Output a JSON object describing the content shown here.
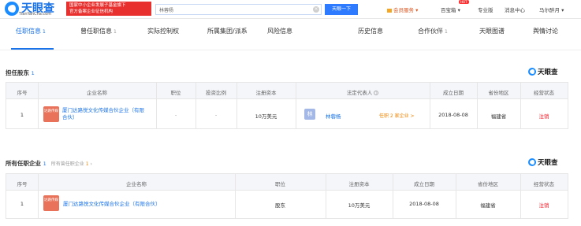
{
  "header": {
    "logo_text": "天眼查",
    "logo_sub": "TianYanCha.com",
    "banner_line1": "国家中小企业发展子基金旗下",
    "banner_line2": "官方备案企业征信机构",
    "search_value": "林蓉杨",
    "search_button": "天眼一下",
    "vip_label": "会员服务",
    "baibaoxiang": "百宝箱",
    "hot_tag": "HOT",
    "pro_label": "专业版",
    "message_label": "消息中心",
    "user_label": "马尔醉月"
  },
  "tabs": [
    {
      "label": "任职信息",
      "count": "1"
    },
    {
      "label": "曾任职信息",
      "count": "1"
    },
    {
      "label": "实际控制权",
      "count": ""
    },
    {
      "label": "所属集团/派系",
      "count": ""
    },
    {
      "label": "风险信息",
      "count": ""
    },
    {
      "label": "历史信息",
      "count": ""
    },
    {
      "label": "合作伙伴",
      "count": "1"
    },
    {
      "label": "天眼图谱",
      "count": ""
    },
    {
      "label": "舆情讨论",
      "count": ""
    }
  ],
  "section1": {
    "title": "担任股东",
    "count": "1",
    "brand": "天眼查",
    "headers": [
      "序号",
      "企业名称",
      "职位",
      "投资比例",
      "注册资本",
      "法定代表人",
      "成立日期",
      "省份地区",
      "经营状态"
    ],
    "row": {
      "index": "1",
      "logo_text": "达路传媒",
      "company": "厦门达路悦文化传媒合伙企业（有限合伙）",
      "position": "-",
      "ratio": "-",
      "capital": "10万美元",
      "rep_avatar": "林",
      "rep_name": "林蓉杨",
      "rep_tag": "任职 2 家企业 >",
      "date": "2018-08-08",
      "region": "福建省",
      "status": "注销"
    }
  },
  "section2": {
    "title": "所有任职企业",
    "count": "1",
    "history_label": "所有曾任职企业",
    "history_count": "1",
    "brand": "天眼查",
    "headers": [
      "序号",
      "企业名称",
      "职位",
      "注册资本",
      "成立日期",
      "省份地区",
      "经营状态"
    ],
    "row": {
      "index": "1",
      "logo_text": "达路传媒",
      "company": "厦门达路悦文化传媒合伙企业（有限合伙）",
      "position": "股东",
      "capital": "10万美元",
      "date": "2018-08-08",
      "region": "福建省",
      "status": "注销"
    }
  },
  "colors": {
    "accent": "#1a73e8",
    "danger": "#f5222d",
    "tag": "#f08300"
  }
}
